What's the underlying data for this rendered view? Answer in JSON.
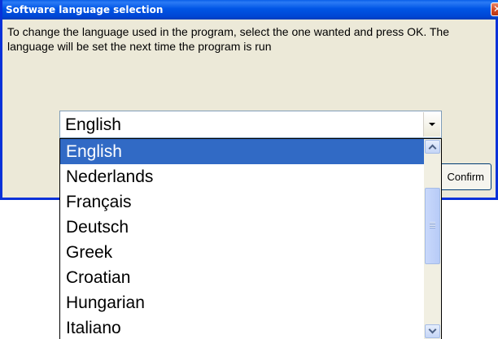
{
  "window": {
    "title": "Software language selection",
    "close_glyph": "✕",
    "message": "To change the language used in the program, select the one wanted and press OK. The language will be set the next time the program is run",
    "confirm_label": "Confirm"
  },
  "combo": {
    "selected_value": "English",
    "options": [
      "English",
      "Nederlands",
      "Français",
      "Deutsch",
      "Greek",
      "Croatian",
      "Hungarian",
      "Italiano"
    ],
    "highlighted_index": 0
  },
  "colors": {
    "title_bar": "#0055e5",
    "window_face": "#ece9d8",
    "selection": "#316ac5",
    "close_button": "#d74a22"
  },
  "icons": {
    "close": "close-icon",
    "dropdown_arrow": "chevron-down-icon",
    "scroll_up": "chevron-up-icon",
    "scroll_down": "chevron-down-icon"
  }
}
